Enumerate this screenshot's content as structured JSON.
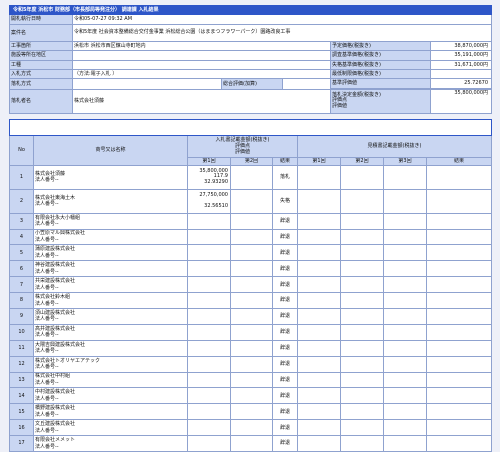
{
  "page_title": "令和5年度 浜松市 財務部（市長部局等発注分） 調達課 入札結果",
  "summary": {
    "date_label": "開札執行日時",
    "date_value": "令和05-07-27 09:32 AM",
    "project_label": "案件名",
    "project_value": "令和5年度 社会資本整備総合交付金事業 浜松総合公園（はままつフラワーパーク）園路改良工事",
    "location_label": "工事箇所",
    "location_value": "浜松市 浜松市西区舘山寺町地内",
    "yotei_label": "予定価格(税抜き)",
    "yotei_value": "38,870,000円",
    "shisetsu_label": "施設等所在地区",
    "chosa_label": "調査基準価格(税抜き)",
    "chosa_value": "35,191,000円",
    "koushu_label": "工種",
    "shikkaku_label": "失格基準価格(税抜き)",
    "shikkaku_value": "31,671,000円",
    "nyusatsu_label": "入札方式",
    "nyusatsu_value": "（方法:電子入札 ）",
    "saitei_label": "最低制限価格(税抜き)",
    "kijun_label": "基準評価値",
    "kijun_value": "25.72670",
    "rakusatsu_label": "落札方式",
    "rakusatsu_value": "総合評価(加算)",
    "kettei_label": "落札決定金額(税抜き)\n評価点\n評価値",
    "kettei_value": "35,800,000円",
    "winner_label": "落札者名",
    "winner_value": "株式会社須藤"
  },
  "bidders": {
    "section_title": "業者一覧",
    "col_no": "No",
    "col_name": "商号又は名称",
    "col_bid_group": "入札書記載金額(税抜き)\n評価点\n評価値",
    "col_confirm_group": "見積書記載金額(税抜き)",
    "col_r1": "第1回",
    "col_r2": "第2回",
    "col_r3": "第3回",
    "col_result": "結果",
    "rows": [
      {
        "no": "1",
        "name": "株式会社須藤\n法人番号--",
        "amount": "35,800,000\n117.9\n32.93290",
        "result": "落札"
      },
      {
        "no": "2",
        "name": "株式会社東海土木\n法人番号--",
        "amount": "27,750,000\n\n32.56510",
        "result": "失格"
      },
      {
        "no": "3",
        "name": "有限会社永大小幡組\n法人番号--",
        "amount": "",
        "result": "辞退"
      },
      {
        "no": "4",
        "name": "小笠原マル興株式会社\n法人番号--",
        "amount": "",
        "result": "辞退"
      },
      {
        "no": "5",
        "name": "蒲原建設株式会社\n法人番号--",
        "amount": "",
        "result": "辞退"
      },
      {
        "no": "6",
        "name": "神谷建設株式会社\n法人番号--",
        "amount": "",
        "result": "辞退"
      },
      {
        "no": "7",
        "name": "共栄建設株式会社\n法人番号--",
        "amount": "",
        "result": "辞退"
      },
      {
        "no": "8",
        "name": "株式会社鈴木組\n法人番号--",
        "amount": "",
        "result": "辞退"
      },
      {
        "no": "9",
        "name": "須山建設株式会社\n法人番号--",
        "amount": "",
        "result": "辞退"
      },
      {
        "no": "10",
        "name": "高井建設株式会社\n法人番号--",
        "amount": "",
        "result": "辞退"
      },
      {
        "no": "11",
        "name": "大隈吉興建設株式会社\n法人番号--",
        "amount": "",
        "result": "辞退"
      },
      {
        "no": "12",
        "name": "株式会社トオリヤエアテック\n法人番号--",
        "amount": "",
        "result": "辞退"
      },
      {
        "no": "13",
        "name": "株式会社中村組\n法人番号--",
        "amount": "",
        "result": "辞退"
      },
      {
        "no": "14",
        "name": "中村建設株式会社\n法人番号--",
        "amount": "",
        "result": "辞退"
      },
      {
        "no": "15",
        "name": "橋野建設株式会社\n法人番号--",
        "amount": "",
        "result": "辞退"
      },
      {
        "no": "16",
        "name": "文丘建設株式会社\n法人番号--",
        "amount": "",
        "result": "辞退"
      },
      {
        "no": "17",
        "name": "有限会社メメット\n法人番号--",
        "amount": "",
        "result": "辞退"
      }
    ]
  },
  "colors": {
    "header_bg": "#2e56c8",
    "label_bg": "#c9d6f2",
    "border": "#8fa2cf",
    "page_bg": "#eef0f8"
  }
}
